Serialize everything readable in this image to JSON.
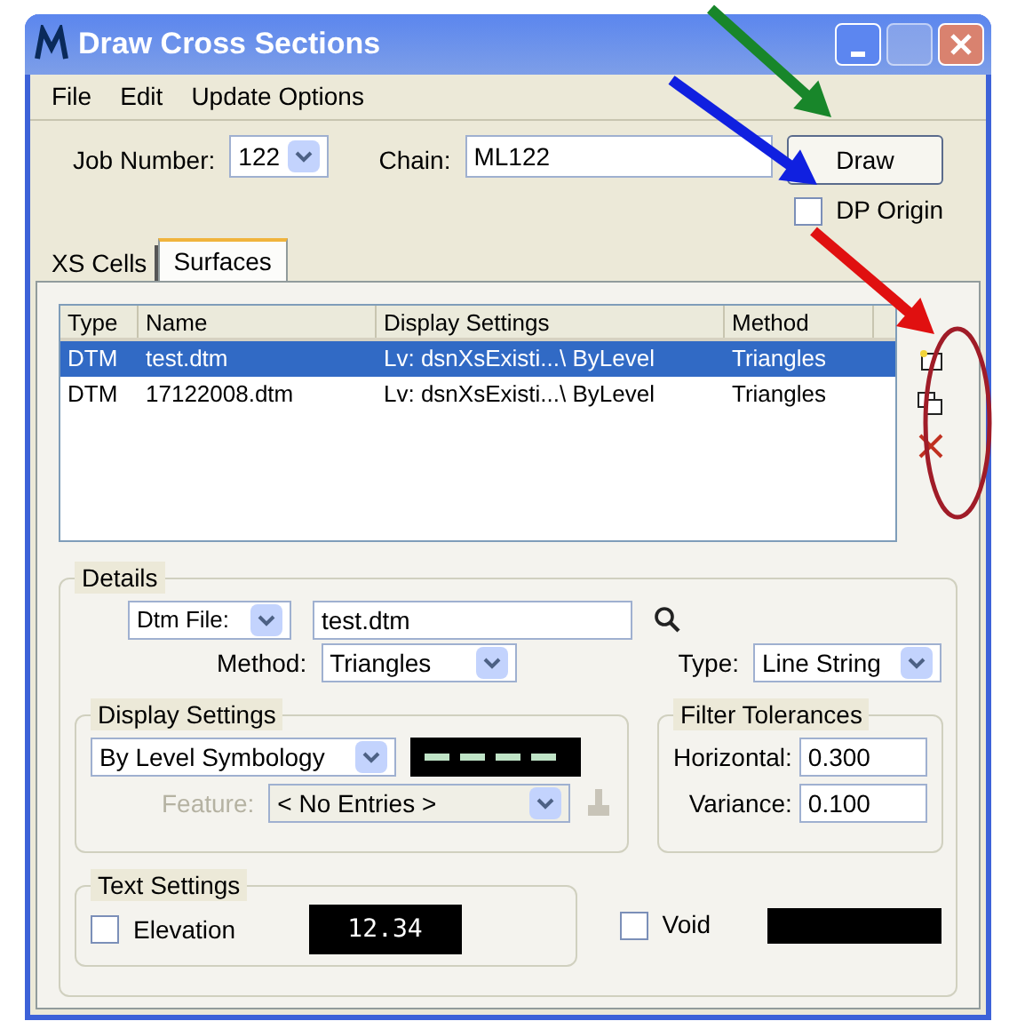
{
  "window": {
    "title": "Draw Cross Sections"
  },
  "menu": [
    "File",
    "Edit",
    "Update Options"
  ],
  "job_number": {
    "label": "Job Number:",
    "value": "122"
  },
  "chain": {
    "label": "Chain:",
    "value": "ML122"
  },
  "draw_button": "Draw",
  "dp_origin": {
    "label": "DP Origin",
    "checked": false
  },
  "tabs": [
    {
      "label": "XS Cells",
      "selected": false
    },
    {
      "label": "Surfaces",
      "selected": true
    }
  ],
  "table": {
    "columns": [
      "Type",
      "Name",
      "Display Settings",
      "Method"
    ],
    "rows": [
      {
        "cells": [
          "DTM",
          "test.dtm",
          "Lv: dsnXsExisti...\\ ByLevel",
          "Triangles"
        ],
        "selected": true
      },
      {
        "cells": [
          "DTM",
          "17122008.dtm",
          "Lv: dsnXsExisti...\\ ByLevel",
          "Triangles"
        ],
        "selected": false
      }
    ]
  },
  "details": {
    "title": "Details",
    "file_mode": "Dtm File:",
    "file": "test.dtm",
    "method_label": "Method:",
    "method": "Triangles",
    "type_label": "Type:",
    "type": "Line String"
  },
  "display_settings": {
    "title": "Display Settings",
    "symbology": "By Level Symbology",
    "feature_label": "Feature:",
    "feature": "< No Entries >",
    "feature_disabled": true
  },
  "filter_tolerances": {
    "title": "Filter Tolerances",
    "fields": [
      {
        "label": "Horizontal:",
        "value": "0.300"
      },
      {
        "label": "Variance:",
        "value": "0.100"
      }
    ]
  },
  "text_settings": {
    "title": "Text Settings",
    "elevation": {
      "label": "Elevation",
      "checked": false
    },
    "preview": "12.34"
  },
  "void": {
    "label": "Void",
    "checked": false
  },
  "annotations": [
    {
      "kind": "arrow",
      "color": "#18862a"
    },
    {
      "kind": "arrow",
      "color": "#1020e0"
    },
    {
      "kind": "arrow",
      "color": "#e01010"
    },
    {
      "kind": "ellipse",
      "color": "#a01c28"
    }
  ]
}
